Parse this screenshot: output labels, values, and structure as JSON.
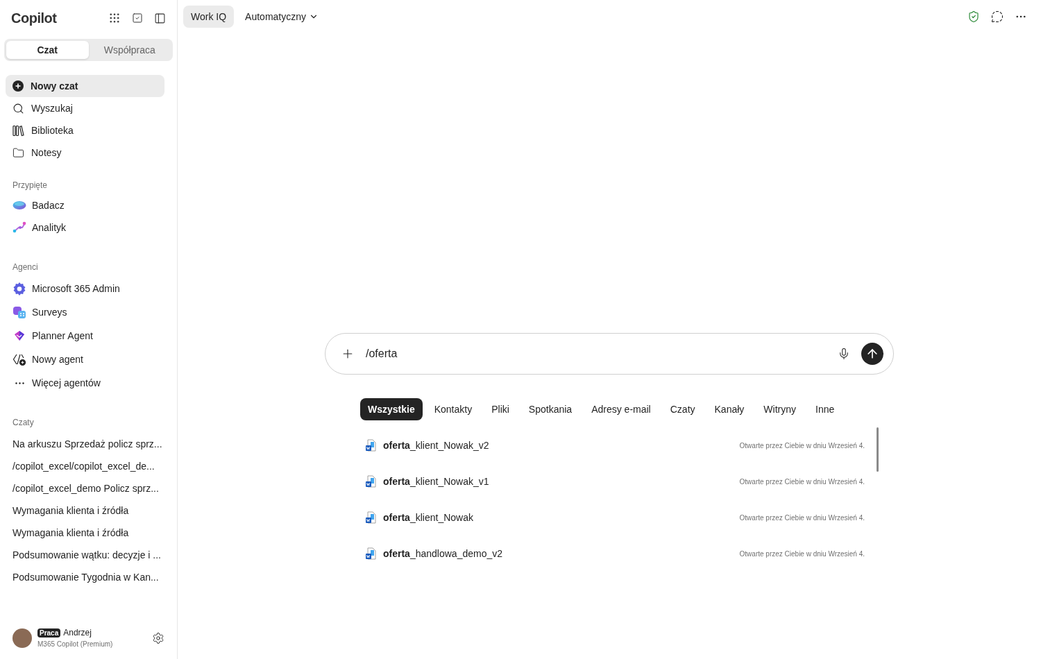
{
  "sidebar": {
    "title": "Copilot",
    "mode_tabs": [
      {
        "label": "Czat",
        "selected": true
      },
      {
        "label": "Współpraca",
        "selected": false
      }
    ],
    "nav": [
      {
        "label": "Nowy czat",
        "kind": "new",
        "selected": true
      },
      {
        "label": "Wyszukaj",
        "kind": "search",
        "selected": false
      },
      {
        "label": "Biblioteka",
        "kind": "library",
        "selected": false
      },
      {
        "label": "Notesy",
        "kind": "folder",
        "selected": false
      }
    ],
    "pinned": {
      "heading": "Przypięte",
      "items": [
        {
          "label": "Badacz",
          "kind": "researcher"
        },
        {
          "label": "Analityk",
          "kind": "analyst"
        }
      ]
    },
    "agents": {
      "heading": "Agenci",
      "items": [
        {
          "label": "Microsoft 365 Admin",
          "kind": "admin"
        },
        {
          "label": "Surveys",
          "kind": "surveys"
        },
        {
          "label": "Planner Agent",
          "kind": "planner"
        },
        {
          "label": "Nowy agent",
          "kind": "new-agent"
        },
        {
          "label": "Więcej agentów",
          "kind": "more"
        }
      ]
    },
    "chats": {
      "heading": "Czaty",
      "items": [
        "Na arkuszu Sprzedaż policz sprz...",
        "/copilot_excel/copilot_excel_de...",
        "/copilot_excel_demo Policz sprz...",
        "Wymagania klienta i źródła",
        "Wymagania klienta i źródła",
        "Podsumowanie wątku: decyzje i ...",
        "Podsumowanie Tygodnia w Kan..."
      ]
    },
    "user": {
      "badge": "Praca",
      "name": "Andrzej",
      "plan": "M365 Copilot (Premium)"
    }
  },
  "topbar": {
    "work_iq": "Work IQ",
    "model": "Automatyczny"
  },
  "composer": {
    "value": "/oferta"
  },
  "filters": [
    {
      "label": "Wszystkie",
      "selected": true
    },
    {
      "label": "Kontakty",
      "selected": false
    },
    {
      "label": "Pliki",
      "selected": false
    },
    {
      "label": "Spotkania",
      "selected": false
    },
    {
      "label": "Adresy e-mail",
      "selected": false
    },
    {
      "label": "Czaty",
      "selected": false
    },
    {
      "label": "Kanały",
      "selected": false
    },
    {
      "label": "Witryny",
      "selected": false
    },
    {
      "label": "Inne",
      "selected": false
    }
  ],
  "results": [
    {
      "name": "**oferta**_klient_Nowak_v2",
      "detail": "Otwarte przez Ciebie w dniu Wrzesień 4."
    },
    {
      "name": "**oferta**_klient_Nowak_v1",
      "detail": "Otwarte przez Ciebie w dniu Wrzesień 4."
    },
    {
      "name": "**oferta**_klient_Nowak",
      "detail": "Otwarte przez Ciebie w dniu Wrzesień 4."
    },
    {
      "name": "**oferta**_handlowa_demo_v2",
      "detail": "Otwarte przez Ciebie w dniu Wrzesień 4."
    }
  ]
}
